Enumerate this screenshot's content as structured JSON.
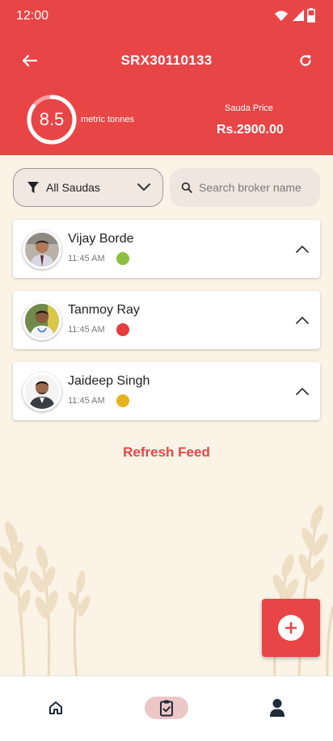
{
  "status_bar": {
    "time": "12:00"
  },
  "header": {
    "title": "SRX30110133",
    "gauge_value": "8.5",
    "gauge_fraction": 0.85,
    "unit_label": "metric tonnes",
    "price_caption": "Sauda Price",
    "price_value": "Rs.2900.00"
  },
  "filters": {
    "dropdown_label": "All Saudas",
    "search_placeholder": "Search broker name"
  },
  "brokers": [
    {
      "name": "Vijay Borde",
      "time": "11:45 AM",
      "status_color": "#8cbf3f"
    },
    {
      "name": "Tanmoy Ray",
      "time": "11:45 AM",
      "status_color": "#e33e3e"
    },
    {
      "name": "Jaideep Singh",
      "time": "11:45 AM",
      "status_color": "#e6b320"
    }
  ],
  "refresh_feed_label": "Refresh Feed",
  "colors": {
    "accent": "#e84547",
    "background": "#fbf3e6",
    "nav_active": "#ecc7c7"
  },
  "icons": {
    "back": "arrow-left-icon",
    "refresh": "refresh-icon",
    "filter": "filter-icon",
    "dropdown": "chevron-down-icon",
    "search": "search-icon",
    "expand": "chevron-up-icon",
    "add": "plus-icon",
    "home": "home-icon",
    "tasks": "clipboard-check-icon",
    "profile": "person-icon"
  }
}
